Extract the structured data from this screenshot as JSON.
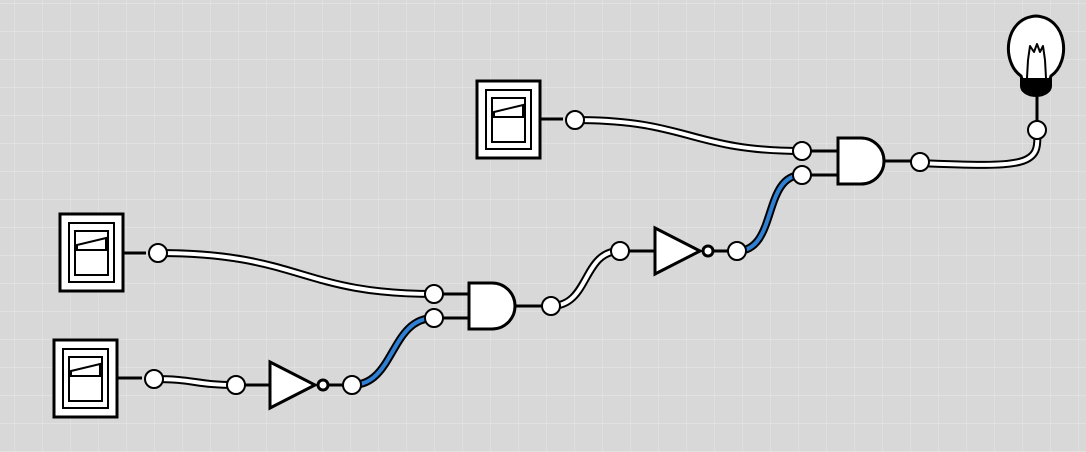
{
  "colors": {
    "background": "#d8d8d8",
    "grid": "#e6e6e6",
    "stroke": "#000000",
    "wire_off": "#ffffff",
    "wire_on": "#2f7fd2",
    "bulb_glass": "#ffffff",
    "bulb_base": "#000000"
  },
  "components": {
    "switches": [
      {
        "id": "switch-top",
        "icon": "toggle-switch-icon",
        "state": "off"
      },
      {
        "id": "switch-middle",
        "icon": "toggle-switch-icon",
        "state": "off"
      },
      {
        "id": "switch-bottom",
        "icon": "toggle-switch-icon",
        "state": "off"
      }
    ],
    "not_gates": [
      {
        "id": "not-gate-lower",
        "icon": "not-gate-icon"
      },
      {
        "id": "not-gate-upper",
        "icon": "not-gate-icon"
      }
    ],
    "and_gates": [
      {
        "id": "and-gate-lower",
        "icon": "and-gate-icon"
      },
      {
        "id": "and-gate-upper",
        "icon": "and-gate-icon"
      }
    ],
    "output": {
      "id": "light-bulb",
      "icon": "light-bulb-icon",
      "state": "off"
    }
  },
  "wires": [
    {
      "id": "wire-switch-top-to-and-upper",
      "state": "off"
    },
    {
      "id": "wire-switch-middle-to-and-lower",
      "state": "off"
    },
    {
      "id": "wire-switch-bottom-to-not-lower",
      "state": "off"
    },
    {
      "id": "wire-not-lower-to-and-lower",
      "state": "on"
    },
    {
      "id": "wire-and-lower-to-not-upper",
      "state": "off"
    },
    {
      "id": "wire-not-upper-to-and-upper",
      "state": "on"
    },
    {
      "id": "wire-and-upper-to-bulb",
      "state": "off"
    }
  ]
}
